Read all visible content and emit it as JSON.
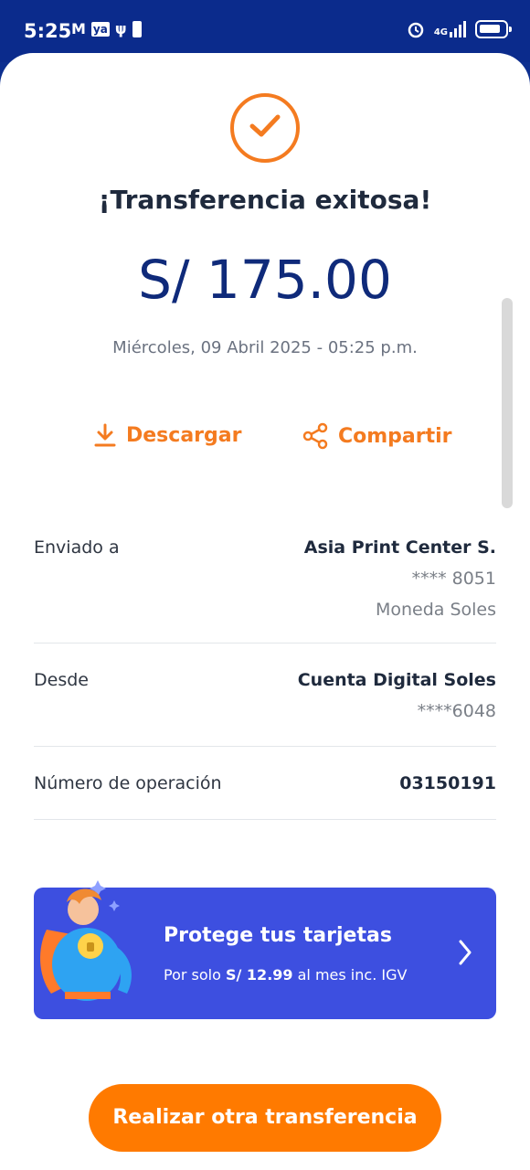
{
  "statusbar": {
    "time": "5:25",
    "icons_left": [
      "mail-icon",
      "ya-icon",
      "usb-icon",
      "battery-saver-icon"
    ],
    "network": "4G",
    "icons_right": [
      "alarm-icon",
      "signal-icon",
      "battery-icon"
    ]
  },
  "receipt": {
    "title": "¡Transferencia exitosa!",
    "amount": "S/ 175.00",
    "datetime": "Miércoles, 09 Abril 2025 - 05:25 p.m."
  },
  "actions": {
    "download_label": "Descargar",
    "share_label": "Compartir"
  },
  "details": {
    "sent_to": {
      "label": "Enviado a",
      "name": "Asia Print Center S.",
      "account": "**** 8051",
      "currency": "Moneda Soles"
    },
    "from": {
      "label": "Desde",
      "name": "Cuenta Digital Soles",
      "account": "****6048"
    },
    "operation": {
      "label": "Número de operación",
      "value": "03150191"
    }
  },
  "promo": {
    "title": "Protege tus tarjetas",
    "sub_prefix": "Por solo ",
    "sub_price": "S/ 12.99",
    "sub_suffix": " al mes inc. IGV"
  },
  "cta_label": "Realizar otra transferencia",
  "colors": {
    "accent": "#f47b20",
    "primary": "#0f2a7a",
    "promo_bg": "#3d4fe0",
    "statusbar": "#0b2b8c"
  }
}
